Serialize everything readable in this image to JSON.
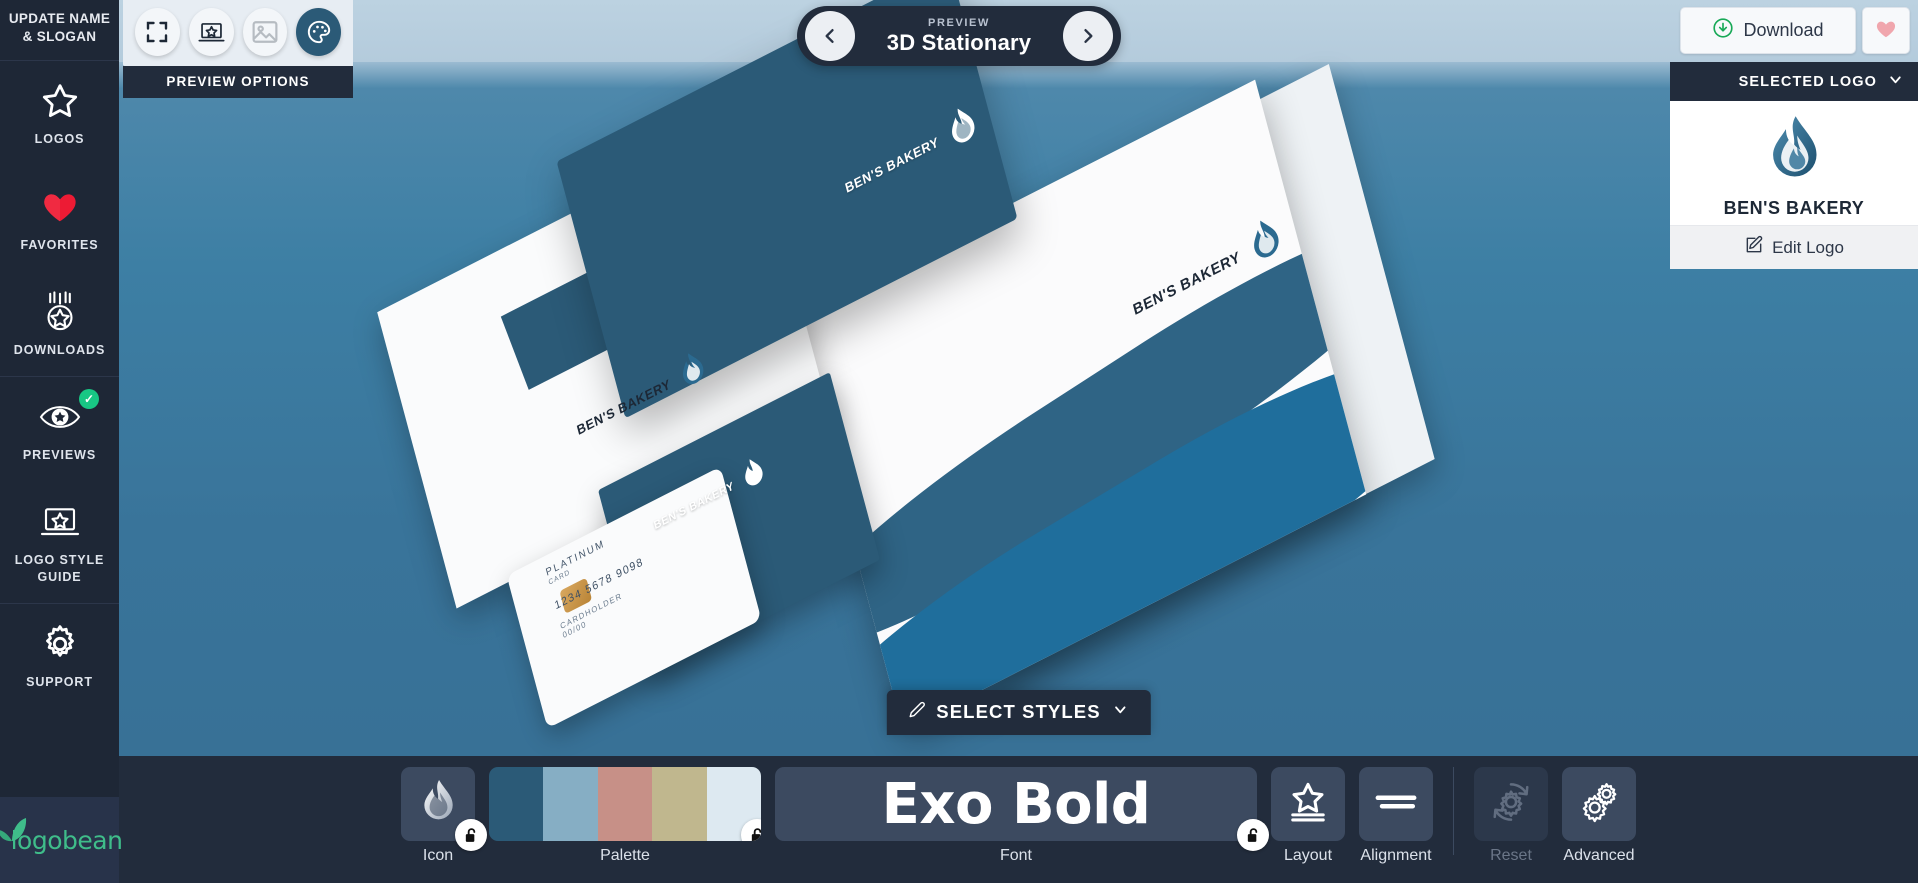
{
  "brand": {
    "name": "logobean"
  },
  "sidebar": {
    "header": "UPDATE NAME & SLOGAN",
    "items": [
      {
        "label": "LOGOS",
        "icon": "star-outline-icon",
        "badge": null
      },
      {
        "label": "FAVORITES",
        "icon": "heart-icon",
        "badge": null
      },
      {
        "label": "DOWNLOADS",
        "icon": "download-star-icon",
        "badge": null
      },
      {
        "label": "PREVIEWS",
        "icon": "eye-star-icon",
        "badge": "✓"
      },
      {
        "label": "LOGO STYLE GUIDE",
        "icon": "laptop-star-icon",
        "badge": null
      },
      {
        "label": "SUPPORT",
        "icon": "gear-icon",
        "badge": null
      }
    ]
  },
  "preview_options": {
    "label": "PREVIEW OPTIONS",
    "buttons": [
      {
        "name": "fullscreen-icon",
        "active": false,
        "dim": false
      },
      {
        "name": "laptop-star-icon",
        "active": false,
        "dim": false
      },
      {
        "name": "image-icon",
        "active": false,
        "dim": true
      },
      {
        "name": "palette-icon",
        "active": true,
        "dim": false
      }
    ]
  },
  "header": {
    "kicker": "PREVIEW",
    "title": "3D Stationary",
    "prev_icon": "chevron-left-icon",
    "next_icon": "chevron-right-icon"
  },
  "topright": {
    "download_label": "Download",
    "download_icon": "download-circle-icon",
    "favorite_icon": "heart-icon",
    "selected_logo_label": "SELECTED LOGO",
    "selected_logo_chevron": "chevron-down-icon",
    "logo_name": "BEN'S BAKERY",
    "edit_logo_label": "Edit Logo",
    "edit_icon": "pencil-square-icon"
  },
  "select_styles": {
    "label": "SELECT STYLES",
    "pencil_icon": "pencil-icon",
    "chevron_icon": "chevron-down-icon"
  },
  "mockup": {
    "logo_text": "BEN'S BAKERY",
    "card_tier": "PLATINUM",
    "card_sub": "CARD",
    "card_number": "1234 5678 9098",
    "card_holder": "CARDHOLDER",
    "card_expiry": "00/00"
  },
  "bottombar": {
    "tools": [
      {
        "label": "Icon",
        "type": "icon",
        "locked": false,
        "disabled": false,
        "lock_icon": "unlock-icon"
      },
      {
        "label": "Palette",
        "type": "palette",
        "locked": false,
        "disabled": false,
        "lock_icon": "unlock-icon"
      },
      {
        "label": "Font",
        "type": "font",
        "value": "Exo Bold",
        "locked": false,
        "disabled": false,
        "lock_icon": "unlock-icon"
      },
      {
        "label": "Layout",
        "type": "layout",
        "disabled": false
      },
      {
        "label": "Alignment",
        "type": "alignment",
        "disabled": false
      },
      {
        "label": "Reset",
        "type": "reset",
        "disabled": true
      },
      {
        "label": "Advanced",
        "type": "advanced",
        "disabled": false
      }
    ],
    "palette_colors": [
      "#2b5a77",
      "#86aec4",
      "#c79087",
      "#c0b78e",
      "#dde9f1"
    ]
  },
  "colors": {
    "sidebar_bg": "#1e2736",
    "panel_dark": "#222c3c",
    "accent_blue": "#2b5a77",
    "green": "#18c784",
    "brand_green": "#3fbd8a",
    "heart_red": "#ed1b34",
    "heart_pink": "#f0a6ad"
  }
}
